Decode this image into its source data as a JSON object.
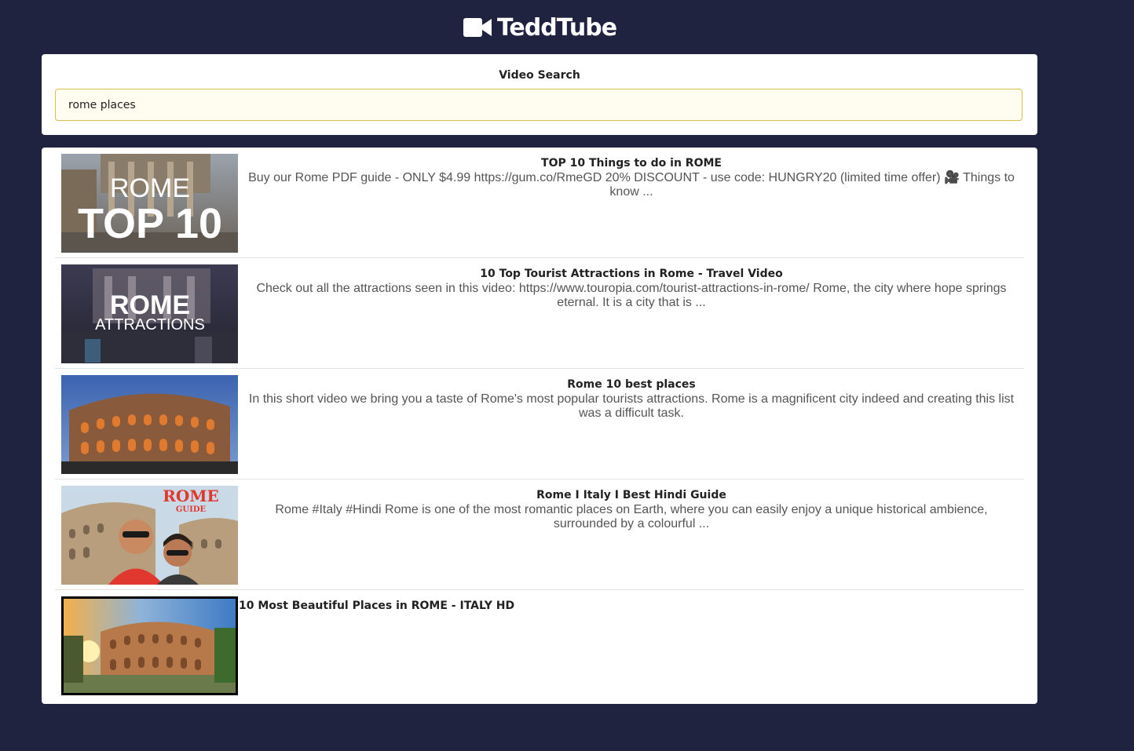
{
  "app": {
    "logo_icon": "video-camera-icon",
    "title": "TeddTube"
  },
  "search": {
    "label": "Video Search",
    "value": "rome places"
  },
  "videos": [
    {
      "title": "TOP 10 Things to do in ROME",
      "description": "Buy our Rome PDF guide - ONLY $4.99 https://gum.co/RmeGD 20% DISCOUNT - use code: HUNGRY20 (limited time offer) 🎥 Things to know ...",
      "thumb_line1": "ROME",
      "thumb_line2": "TOP 10"
    },
    {
      "title": "10 Top Tourist Attractions in Rome - Travel Video",
      "description": "Check out all the attractions seen in this video: https://www.touropia.com/tourist-attractions-in-rome/ Rome, the city where hope springs eternal. It is a city that is ...",
      "thumb_line1": "ROME",
      "thumb_line2": "ATTRACTIONS"
    },
    {
      "title": "Rome 10 best places",
      "description": "In this short video we bring you a taste of Rome's most popular tourists attractions. Rome is a magnificent city indeed and creating this list was a difficult task."
    },
    {
      "title": "Rome I Italy I Best Hindi Guide",
      "description": "Rome #Italy #Hindi Rome is one of the most romantic places on Earth, where you can easily enjoy a unique historical ambience, surrounded by a colourful ...",
      "thumb_line1": "ROME",
      "thumb_line2": "GUIDE"
    },
    {
      "title": "10 Most Beautiful Places in ROME - ITALY HD",
      "description": ""
    }
  ]
}
